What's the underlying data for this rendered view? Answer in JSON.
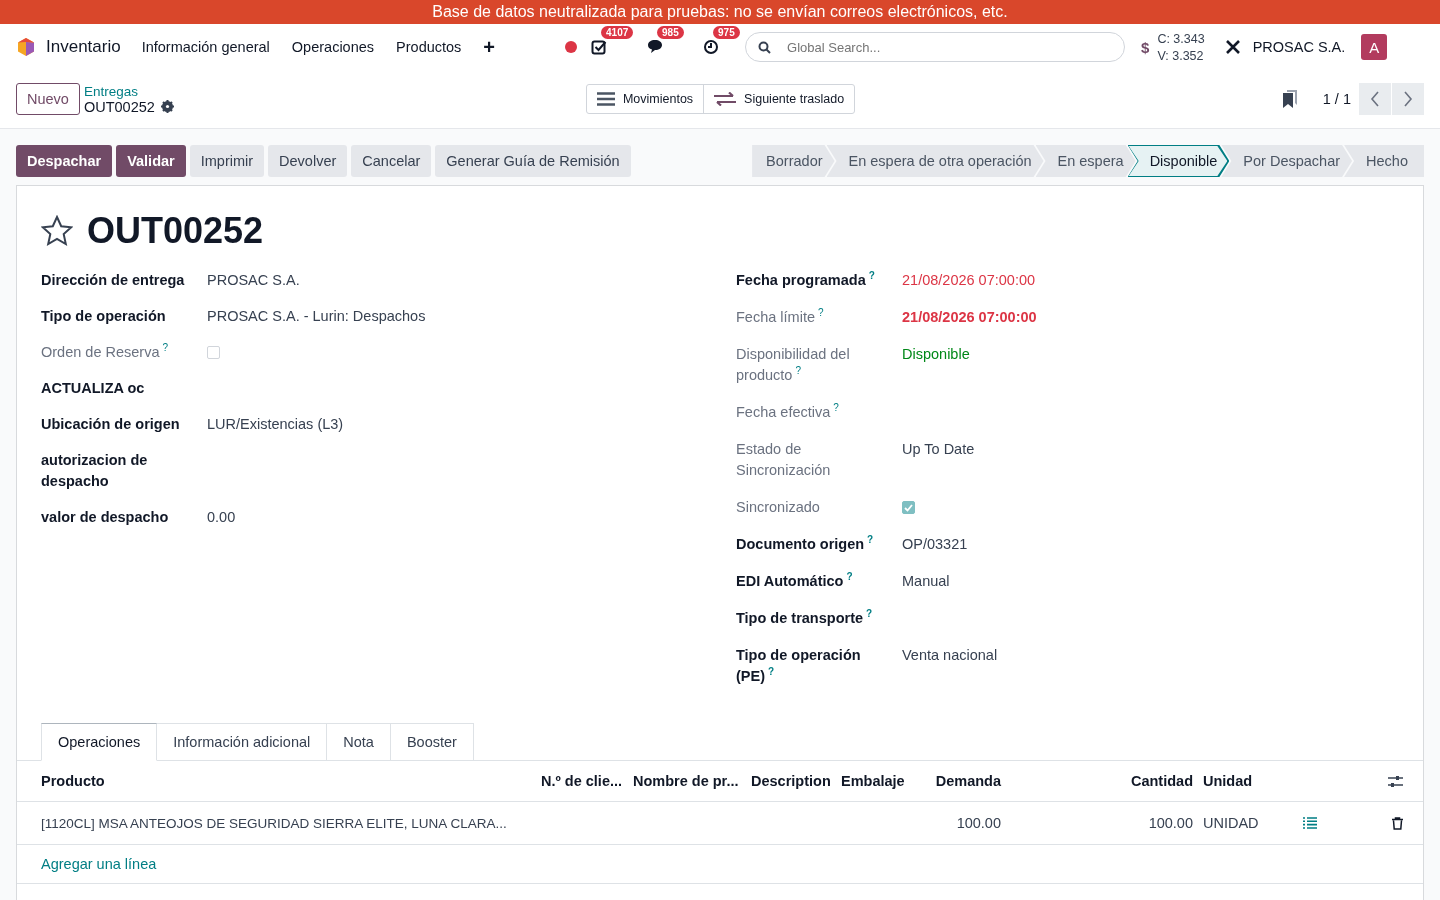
{
  "banner": {
    "text": "Base de datos neutralizada para pruebas: no se envían correos electrónicos, etc."
  },
  "navbar": {
    "app": "Inventario",
    "menu": [
      "Información general",
      "Operaciones",
      "Productos"
    ],
    "add": "+",
    "counters": [
      {
        "kind": "activity",
        "count": "4107"
      },
      {
        "kind": "messages",
        "count": "985"
      },
      {
        "kind": "timer",
        "count": "975"
      }
    ],
    "search": {
      "placeholder": "Global Search..."
    },
    "rates": {
      "symbol": "$",
      "buy": "C: 3.343",
      "sell": "V: 3.352"
    },
    "company": "PROSAC S.A.",
    "avatar": "A"
  },
  "control_panel": {
    "new_button": "Nuevo",
    "breadcrumb": "Entregas",
    "record": "OUT00252",
    "actions": [
      {
        "kind": "list",
        "label": "Movimientos"
      },
      {
        "kind": "transfer",
        "label": "Siguiente traslado"
      }
    ],
    "pager": "1 / 1"
  },
  "buttons": [
    {
      "label": "Despachar",
      "kind": "primary"
    },
    {
      "label": "Validar",
      "kind": "primary"
    },
    {
      "label": "Imprimir",
      "kind": "secondary"
    },
    {
      "label": "Devolver",
      "kind": "secondary"
    },
    {
      "label": "Cancelar",
      "kind": "secondary"
    },
    {
      "label": "Generar Guía de Remisión",
      "kind": "secondary"
    }
  ],
  "stages": [
    {
      "label": "Borrador",
      "selected": false
    },
    {
      "label": "En espera de otra operación",
      "selected": false
    },
    {
      "label": "En espera",
      "selected": false
    },
    {
      "label": "Disponible",
      "selected": true
    },
    {
      "label": "Por Despachar",
      "selected": false
    },
    {
      "label": "Hecho",
      "selected": false
    }
  ],
  "title": {
    "name": "OUT00252",
    "starred": false
  },
  "left_fields": [
    {
      "label": "Dirección de entrega",
      "muted": false,
      "kind": "text",
      "value": "PROSAC S.A."
    },
    {
      "label": "Tipo de operación",
      "muted": false,
      "kind": "text",
      "value": "PROSAC S.A. - Lurin: Despachos"
    },
    {
      "label": "Orden de Reserva",
      "help": "?",
      "muted": true,
      "kind": "checkbox",
      "checked": false
    },
    {
      "label": "ACTUALIZA oc",
      "muted": false,
      "kind": "text"
    },
    {
      "label": "Ubicación de origen",
      "muted": false,
      "kind": "text",
      "value": "LUR/Existencias (L3)"
    },
    {
      "label": "autorizacion de despacho",
      "muted": false,
      "kind": "text"
    },
    {
      "label": "valor de despacho",
      "muted": false,
      "kind": "text",
      "value": "0.00"
    }
  ],
  "right_fields": [
    {
      "label": "Fecha programada",
      "help": "?",
      "muted": false,
      "kind": "text",
      "value": "21/08/2026 07:00:00",
      "color": "#dc3545",
      "strong": false
    },
    {
      "label": "Fecha límite",
      "help": "?",
      "muted": true,
      "kind": "text",
      "value": "21/08/2026 07:00:00",
      "color": "#dc3545",
      "strong": true
    },
    {
      "label": "Disponibilidad del producto",
      "help": "?",
      "muted": true,
      "kind": "text",
      "value": "Disponible",
      "color": "#008818",
      "strong": false
    },
    {
      "label": "Fecha efectiva",
      "help": "?",
      "muted": true,
      "kind": "text"
    },
    {
      "label": "Estado de Sincronización",
      "muted": true,
      "kind": "text",
      "value": "Up To Date"
    },
    {
      "label": "Sincronizado",
      "muted": true,
      "kind": "checkbox",
      "checked": true
    },
    {
      "label": "Documento origen",
      "help": "?",
      "muted": false,
      "kind": "text",
      "value": "OP/03321"
    },
    {
      "label": "EDI Automático",
      "help": "?",
      "muted": false,
      "kind": "text",
      "value": "Manual"
    },
    {
      "label": "Tipo de transporte",
      "help": "?",
      "muted": false,
      "kind": "text"
    },
    {
      "label": "Tipo de operación (PE)",
      "help": "?",
      "muted": false,
      "kind": "text",
      "value": "Venta nacional"
    }
  ],
  "tabs": [
    {
      "label": "Operaciones",
      "selected": true
    },
    {
      "label": "Información adicional",
      "selected": false
    },
    {
      "label": "Nota",
      "selected": false
    },
    {
      "label": "Booster",
      "selected": false
    }
  ],
  "table": {
    "columns": [
      "Producto",
      "N.º de clie...",
      "Nombre de pr...",
      "Description",
      "Embalaje",
      "Demanda",
      "Cantidad",
      "Unidad"
    ],
    "rows": [
      [
        "[1120CL] MSA ANTEOJOS DE SEGURIDAD SIERRA ELITE, LUNA CLARA...",
        "",
        "",
        "",
        "",
        "100.00",
        "100.00",
        "UNIDAD"
      ]
    ],
    "add_line": "Agregar una línea"
  }
}
